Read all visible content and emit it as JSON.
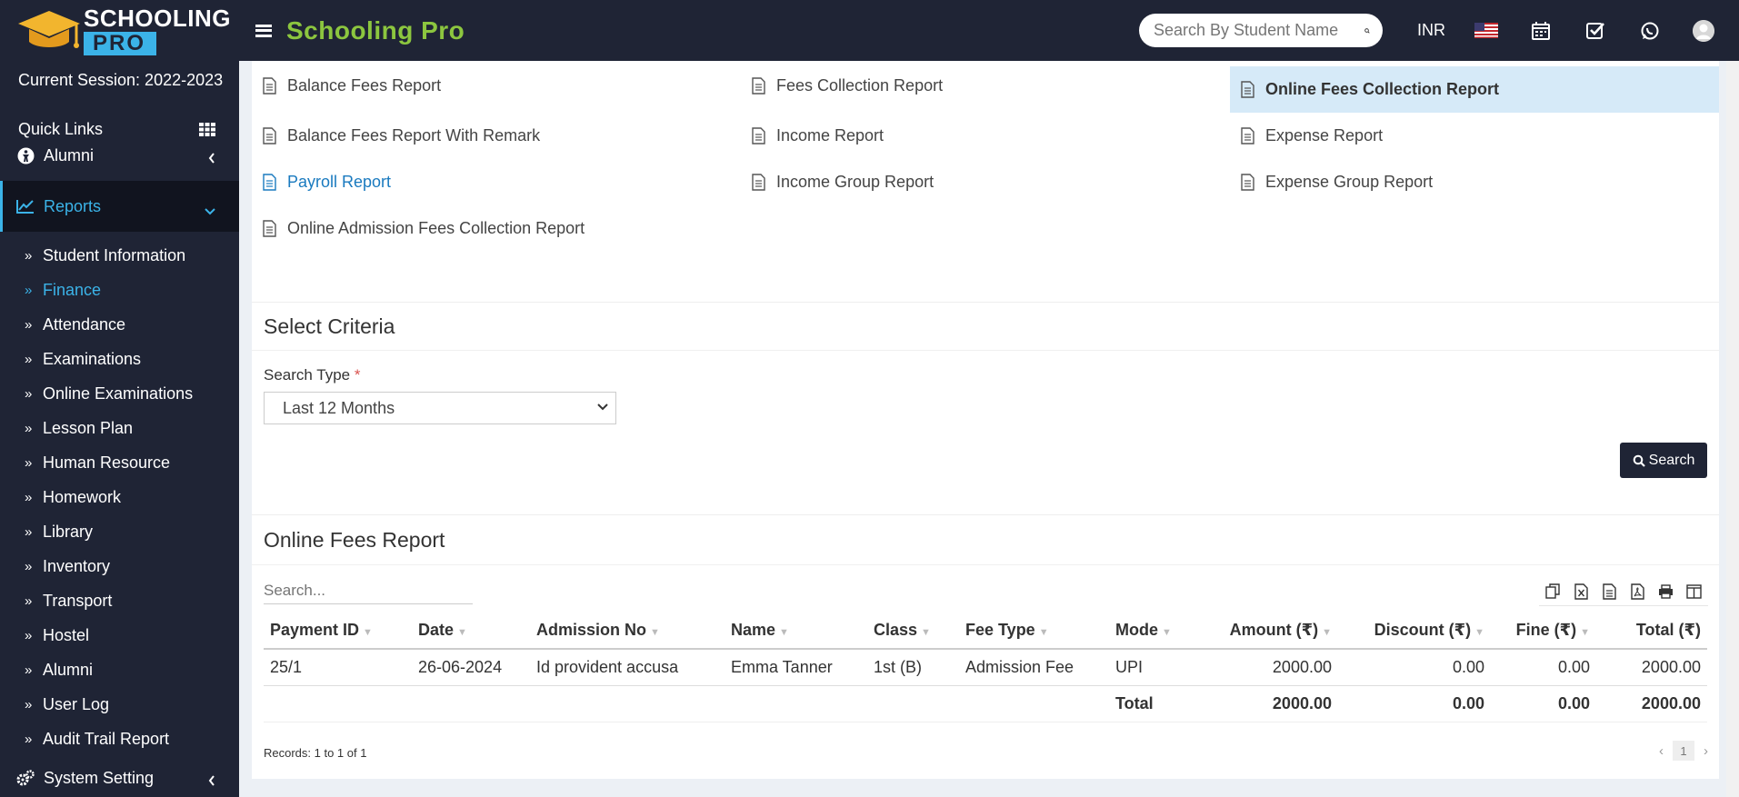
{
  "logo": {
    "line1": "SCHOOLING",
    "line2": "PRO"
  },
  "header": {
    "app_title": "Schooling Pro",
    "search_placeholder": "Search By Student Name",
    "currency": "INR",
    "icons": [
      "search-icon",
      "flag-us-icon",
      "calendar-icon",
      "checkbox-icon",
      "whatsapp-icon",
      "user-avatar-icon"
    ]
  },
  "sidebar": {
    "session": "Current Session: 2022-2023",
    "quick_links": "Quick Links",
    "alumni_top": "Alumni",
    "reports": "Reports",
    "items": [
      "Student Information",
      "Finance",
      "Attendance",
      "Examinations",
      "Online Examinations",
      "Lesson Plan",
      "Human Resource",
      "Homework",
      "Library",
      "Inventory",
      "Transport",
      "Hostel",
      "Alumni",
      "User Log",
      "Audit Trail Report"
    ],
    "system_setting": "System Setting"
  },
  "report_links": {
    "balance_fees": "Balance Fees Report",
    "fees_collection": "Fees Collection Report",
    "online_fees_collection": "Online Fees Collection Report",
    "balance_remark": "Balance Fees Report With Remark",
    "income": "Income Report",
    "expense": "Expense Report",
    "payroll": "Payroll Report",
    "income_group": "Income Group Report",
    "expense_group": "Expense Group Report",
    "online_admission": "Online Admission Fees Collection Report"
  },
  "criteria": {
    "title": "Select Criteria",
    "search_type_label": "Search Type",
    "required_mark": "*",
    "search_type_value": "Last 12 Months",
    "search_button": "Search"
  },
  "report": {
    "title": "Online Fees Report",
    "search_placeholder": "Search...",
    "columns": [
      "Payment ID",
      "Date",
      "Admission No",
      "Name",
      "Class",
      "Fee Type",
      "Mode",
      "Amount (₹)",
      "Discount (₹)",
      "Fine (₹)",
      "Total (₹)"
    ],
    "rows": [
      [
        "25/1",
        "26-06-2024",
        "Id provident accusa",
        "Emma Tanner",
        "1st (B)",
        "Admission Fee",
        "UPI",
        "2000.00",
        "0.00",
        "0.00",
        "2000.00"
      ]
    ],
    "totals": {
      "label": "Total",
      "amount": "2000.00",
      "discount": "0.00",
      "fine": "0.00",
      "total": "2000.00"
    },
    "records": "Records: 1 to 1 of 1",
    "page": "1"
  },
  "colors": {
    "sidebar_bg": "#1f2435",
    "accent": "#3bb3e8",
    "title_green": "#8cc63f",
    "highlight": "#d6eaf8"
  }
}
